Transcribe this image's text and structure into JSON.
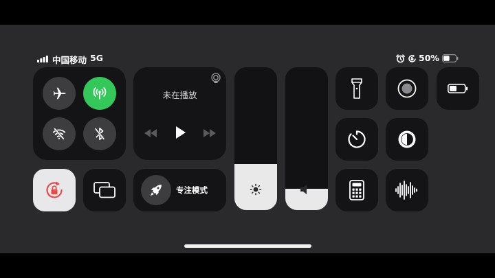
{
  "status_bar": {
    "carrier": "中国移动",
    "network": "5G",
    "battery_percent": "50%",
    "battery_level": 0.5
  },
  "connectivity": {
    "airplane": {
      "icon": "airplane-icon",
      "on": false
    },
    "cellular": {
      "icon": "cellular-antenna-icon",
      "on": true,
      "color": "#34c759"
    },
    "wifi": {
      "icon": "wifi-off-icon",
      "on": false
    },
    "bluetooth": {
      "icon": "bluetooth-off-icon",
      "on": false
    }
  },
  "now_playing": {
    "status": "未在播放",
    "airplay_icon": "airplay-icon",
    "controls": [
      "rewind-icon",
      "play-icon",
      "fast-forward-icon"
    ]
  },
  "focus": {
    "label": "专注模式",
    "icon": "rocket-icon"
  },
  "sliders": {
    "brightness": {
      "level": 0.32,
      "icon": "sun-icon"
    },
    "volume": {
      "level": 0.15,
      "icon": "speaker-icon"
    }
  },
  "toggles": {
    "orientation_lock": {
      "icon": "rotation-lock-icon",
      "on": true,
      "color": "#e84a4a"
    },
    "screen_mirroring": {
      "icon": "screen-mirroring-icon"
    },
    "flashlight": {
      "icon": "flashlight-icon"
    },
    "screen_recording": {
      "icon": "record-icon"
    },
    "low_power": {
      "icon": "battery-icon"
    },
    "timer": {
      "icon": "timer-icon"
    },
    "dark_mode": {
      "icon": "dark-mode-icon"
    },
    "calculator": {
      "icon": "calculator-icon"
    },
    "voice_memos": {
      "icon": "waveform-icon"
    }
  }
}
